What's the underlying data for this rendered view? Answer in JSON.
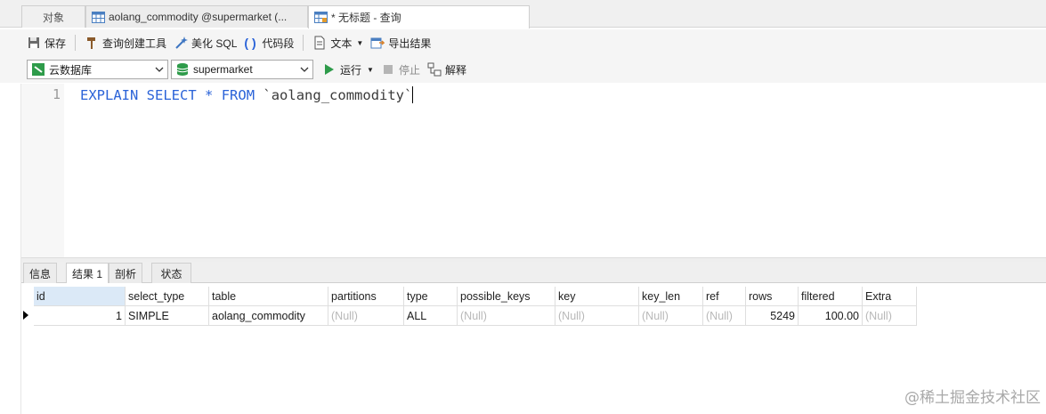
{
  "tabs": [
    {
      "label": "对象"
    },
    {
      "label": "aolang_commodity @supermarket (..."
    },
    {
      "label": "* 无标题 - 查询"
    }
  ],
  "toolbar": {
    "save": "保存",
    "query_builder": "查询创建工具",
    "beautify": "美化 SQL",
    "snippet": "代码段",
    "text": "文本",
    "export": "导出结果"
  },
  "connection": {
    "selected": "云数据库"
  },
  "database": {
    "selected": "supermarket"
  },
  "run_bar": {
    "run": "运行",
    "stop": "停止",
    "explain": "解释"
  },
  "editor": {
    "line_number": "1",
    "keywords": [
      "EXPLAIN",
      "SELECT",
      "*",
      "FROM"
    ],
    "table_ident": "`aolang_commodity`"
  },
  "result_tabs": [
    {
      "label": "信息"
    },
    {
      "label": "结果 1"
    },
    {
      "label": "剖析"
    },
    {
      "label": "状态"
    }
  ],
  "grid": {
    "columns": [
      "id",
      "select_type",
      "table",
      "partitions",
      "type",
      "possible_keys",
      "key",
      "key_len",
      "ref",
      "rows",
      "filtered",
      "Extra"
    ],
    "rows": [
      [
        "1",
        "SIMPLE",
        "aolang_commodity",
        "(Null)",
        "ALL",
        "(Null)",
        "(Null)",
        "(Null)",
        "(Null)",
        "5249",
        "100.00",
        "(Null)"
      ]
    ]
  },
  "watermark": "@稀土掘金技术社区",
  "colors": {
    "keyword": "#2b63d8",
    "null_text": "#b8b8b8",
    "selected_header": "#dbe9f7"
  }
}
